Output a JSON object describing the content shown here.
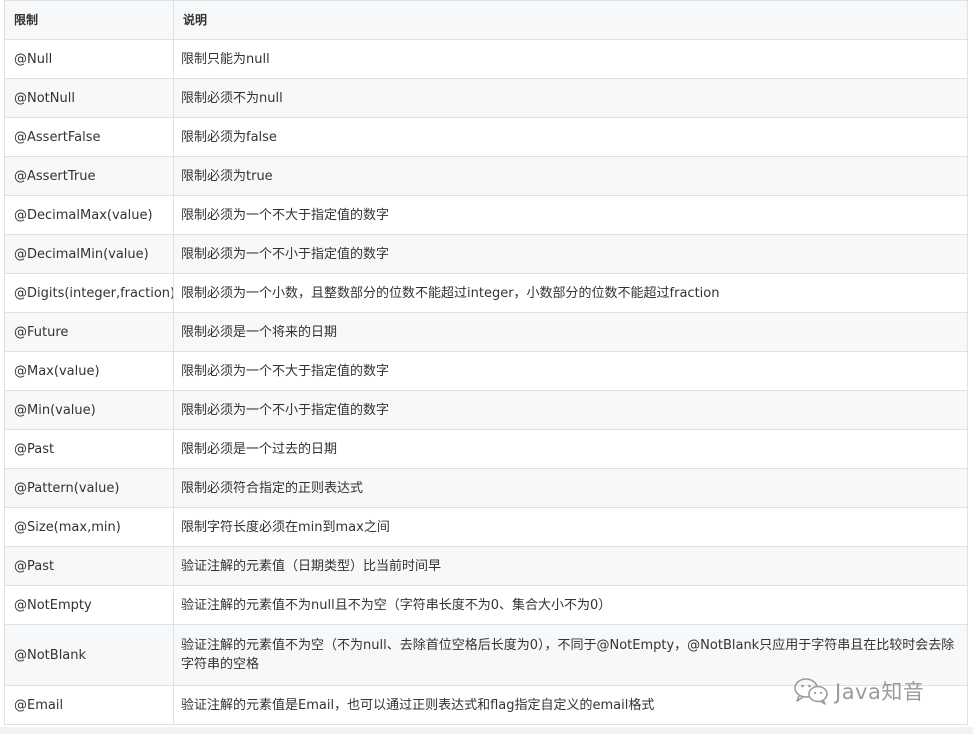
{
  "table": {
    "header": {
      "col_constraint": "限制",
      "col_description": "说明"
    },
    "rows": [
      {
        "constraint": "@Null",
        "description": "限制只能为null"
      },
      {
        "constraint": "@NotNull",
        "description": "限制必须不为null"
      },
      {
        "constraint": "@AssertFalse",
        "description": "限制必须为false"
      },
      {
        "constraint": "@AssertTrue",
        "description": "限制必须为true"
      },
      {
        "constraint": "@DecimalMax(value)",
        "description": "限制必须为一个不大于指定值的数字"
      },
      {
        "constraint": "@DecimalMin(value)",
        "description": "限制必须为一个不小于指定值的数字"
      },
      {
        "constraint": "@Digits(integer,fraction)",
        "description": "限制必须为一个小数，且整数部分的位数不能超过integer，小数部分的位数不能超过fraction"
      },
      {
        "constraint": "@Future",
        "description": "限制必须是一个将来的日期"
      },
      {
        "constraint": "@Max(value)",
        "description": "限制必须为一个不大于指定值的数字"
      },
      {
        "constraint": "@Min(value)",
        "description": "限制必须为一个不小于指定值的数字"
      },
      {
        "constraint": "@Past",
        "description": "限制必须是一个过去的日期"
      },
      {
        "constraint": "@Pattern(value)",
        "description": "限制必须符合指定的正则表达式"
      },
      {
        "constraint": "@Size(max,min)",
        "description": "限制字符长度必须在min到max之间"
      },
      {
        "constraint": "@Past",
        "description": "验证注解的元素值（日期类型）比当前时间早"
      },
      {
        "constraint": "@NotEmpty",
        "description": "验证注解的元素值不为null且不为空（字符串长度不为0、集合大小不为0）"
      },
      {
        "constraint": "@NotBlank",
        "description": "验证注解的元素值不为空（不为null、去除首位空格后长度为0），不同于@NotEmpty，@NotBlank只应用于字符串且在比较时会去除字符串的空格"
      },
      {
        "constraint": "@Email",
        "description": "验证注解的元素值是Email，也可以通过正则表达式和flag指定自定义的email格式"
      }
    ]
  },
  "watermark": {
    "text": "Java知音",
    "icon": "wechat-icon"
  },
  "colors": {
    "header_bg": "#f6f8fa",
    "alt_row_bg": "#f6f8fa",
    "border": "#dfe2e5",
    "text": "#333333"
  }
}
